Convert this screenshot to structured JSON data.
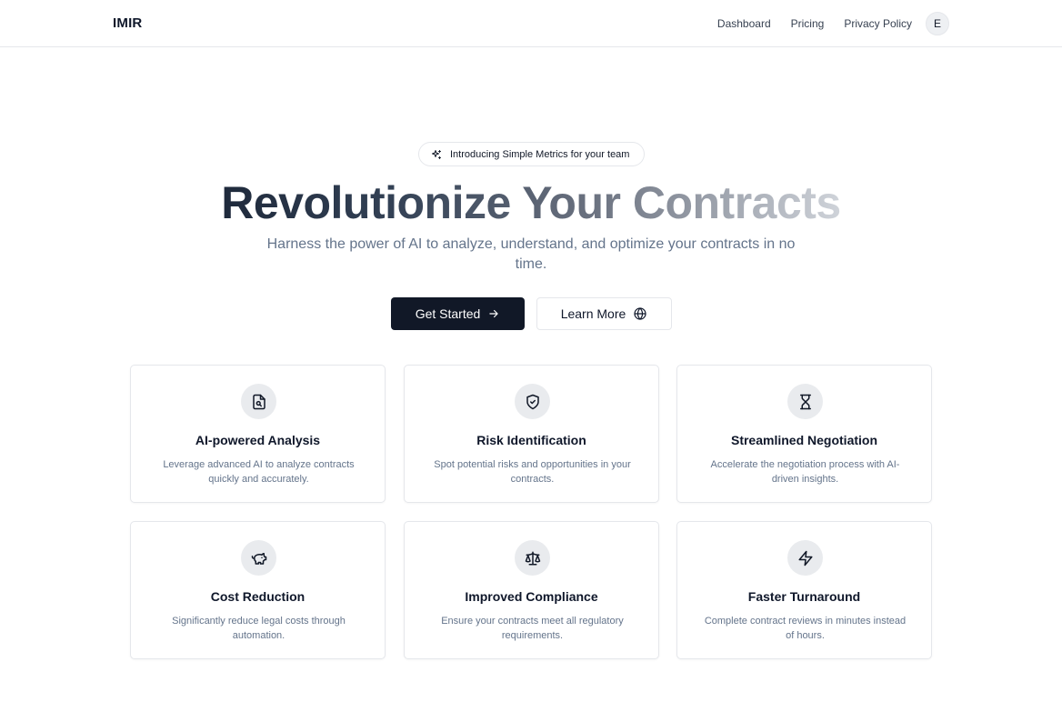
{
  "nav": {
    "logo": "IMIR",
    "links": [
      "Dashboard",
      "Pricing",
      "Privacy Policy"
    ],
    "avatar_initial": "E"
  },
  "hero": {
    "badge": "Introducing Simple Metrics for your team",
    "title": "Revolutionize Your Contracts",
    "subtitle": "Harness the power of AI to analyze, understand, and optimize your contracts in no time.",
    "primary_button": "Get Started",
    "secondary_button": "Learn More"
  },
  "features": [
    {
      "title": "AI-powered Analysis",
      "description": "Leverage advanced AI to analyze contracts quickly and accurately.",
      "icon": "file-search-icon"
    },
    {
      "title": "Risk Identification",
      "description": "Spot potential risks and opportunities in your contracts.",
      "icon": "shield-check-icon"
    },
    {
      "title": "Streamlined Negotiation",
      "description": "Accelerate the negotiation process with AI-driven insights.",
      "icon": "hourglass-icon"
    },
    {
      "title": "Cost Reduction",
      "description": "Significantly reduce legal costs through automation.",
      "icon": "piggy-bank-icon"
    },
    {
      "title": "Improved Compliance",
      "description": "Ensure your contracts meet all regulatory requirements.",
      "icon": "scale-icon"
    },
    {
      "title": "Faster Turnaround",
      "description": "Complete contract reviews in minutes instead of hours.",
      "icon": "zap-icon"
    }
  ],
  "colors": {
    "primary_button_bg": "#111827",
    "icon_circle_bg": "#e9ebee",
    "muted_text": "#64748b"
  }
}
